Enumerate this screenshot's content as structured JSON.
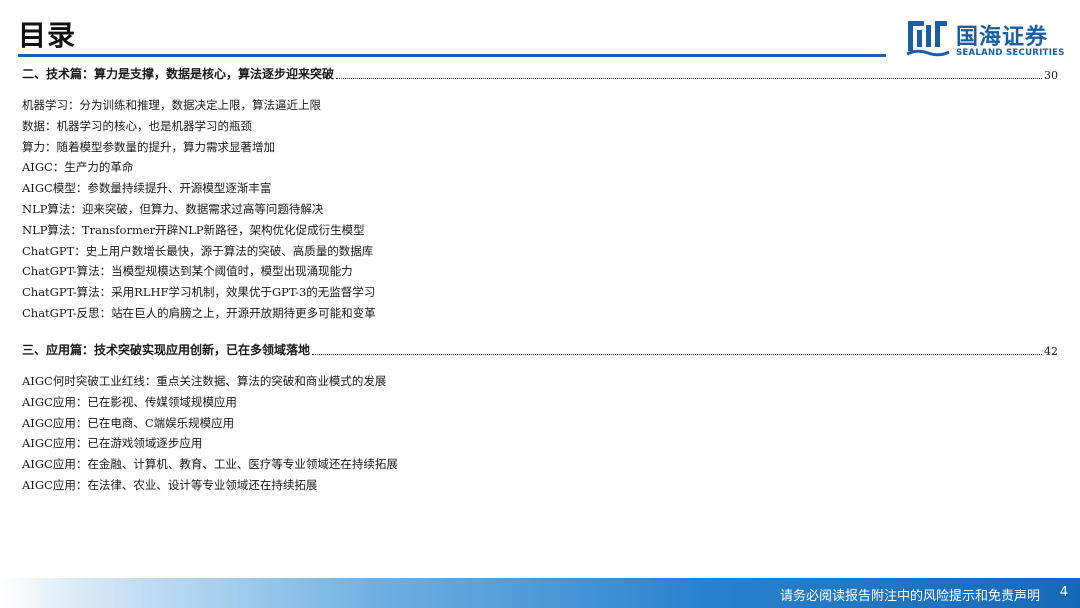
{
  "header": {
    "title": "目录",
    "logo_cn": "国海证券",
    "logo_en": "SEALAND SECURITIES",
    "accent_color": "#1f5fa8"
  },
  "toc": [
    {
      "heading": "二、技术篇：算力是支撑，数据是核心，算法逐步迎来突破",
      "page": "30",
      "items": [
        "机器学习：分为训练和推理，数据决定上限，算法逼近上限",
        "数据：机器学习的核心，也是机器学习的瓶颈",
        "算力：随着模型参数量的提升，算力需求显著增加",
        "AIGC：生产力的革命",
        "AIGC模型：参数量持续提升、开源模型逐渐丰富",
        "NLP算法：迎来突破，但算力、数据需求过高等问题待解决",
        "NLP算法：Transformer开辟NLP新路径，架构优化促成衍生模型",
        "ChatGPT：史上用户数增长最快，源于算法的突破、高质量的数据库",
        "ChatGPT-算法：当模型规模达到某个阈值时，模型出现涌现能力",
        "ChatGPT-算法：采用RLHF学习机制，效果优于GPT-3的无监督学习",
        "ChatGPT-反思：站在巨人的肩膀之上，开源开放期待更多可能和变革"
      ]
    },
    {
      "heading": "三、应用篇：技术突破实现应用创新，已在多领域落地",
      "page": "42",
      "items": [
        "AIGC何时突破工业红线：重点关注数据、算法的突破和商业模式的发展",
        "AIGC应用：已在影视、传媒领域规模应用",
        "AIGC应用：已在电商、C端娱乐规模应用",
        "AIGC应用：已在游戏领域逐步应用",
        "AIGC应用：在金融、计算机、教育、工业、医疗等专业领域还在持续拓展",
        "AIGC应用：在法律、农业、设计等专业领域还在持续拓展"
      ]
    }
  ],
  "footer": {
    "disclaimer": "请务必阅读报告附注中的风险提示和免责声明",
    "page_number": "4"
  }
}
